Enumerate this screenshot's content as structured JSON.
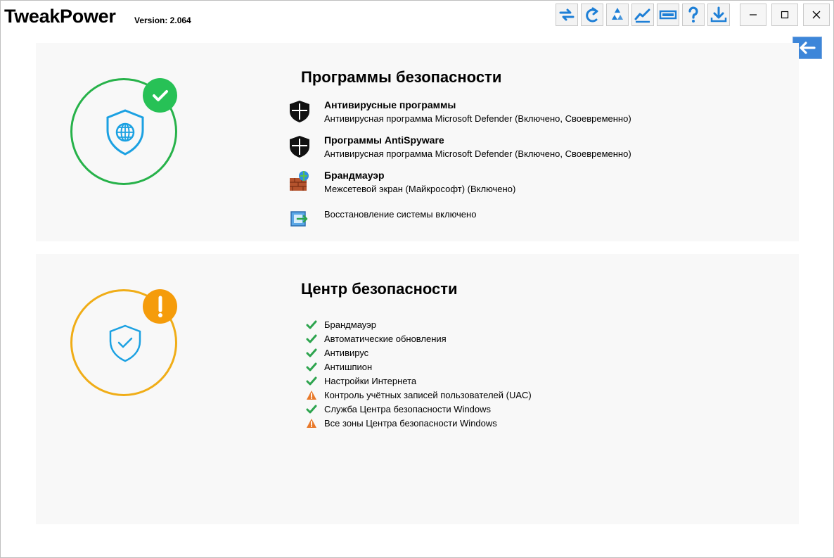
{
  "app": {
    "title": "TweakPower",
    "version": "Version: 2.064"
  },
  "toolbar": {
    "buttons": [
      {
        "icon": "refresh-icon"
      },
      {
        "icon": "redo-icon"
      },
      {
        "icon": "recycle-icon"
      },
      {
        "icon": "chart-line-icon"
      },
      {
        "icon": "ram-icon"
      },
      {
        "icon": "help-icon"
      },
      {
        "icon": "download-icon"
      }
    ]
  },
  "colors": {
    "ok": "#27b24a",
    "warning": "#f0ad17",
    "accent": "#3d86d9",
    "shield": "#1ba1e2"
  },
  "security_programs": {
    "title": "Программы безопасности",
    "status": "ok",
    "items": [
      {
        "name": "Антивирусные программы",
        "desc": "Антивирусная программа Microsoft Defender (Включено, Своевременно)",
        "icon": "shield-icon"
      },
      {
        "name": "Программы AntiSpyware",
        "desc": "Антивирусная программа Microsoft Defender (Включено, Своевременно)",
        "icon": "shield-icon"
      },
      {
        "name": "Брандмауэр",
        "desc": "Межсетевой экран (Майкрософт) (Включено)",
        "icon": "firewall-icon"
      }
    ],
    "restore": {
      "text": "Восстановление системы включено",
      "icon": "system-restore-icon"
    }
  },
  "security_center": {
    "title": "Центр безопасности",
    "status": "warning",
    "items": [
      {
        "label": "Брандмауэр",
        "state": "ok"
      },
      {
        "label": "Автоматические обновления",
        "state": "ok"
      },
      {
        "label": "Антивирус",
        "state": "ok"
      },
      {
        "label": "Антишпион",
        "state": "ok"
      },
      {
        "label": "Настройки Интернета",
        "state": "ok"
      },
      {
        "label": "Контроль учётных записей пользователей (UAC)",
        "state": "warning"
      },
      {
        "label": "Служба Центра безопасности Windows",
        "state": "ok"
      },
      {
        "label": "Все зоны Центра безопасности Windows",
        "state": "warning"
      }
    ]
  }
}
